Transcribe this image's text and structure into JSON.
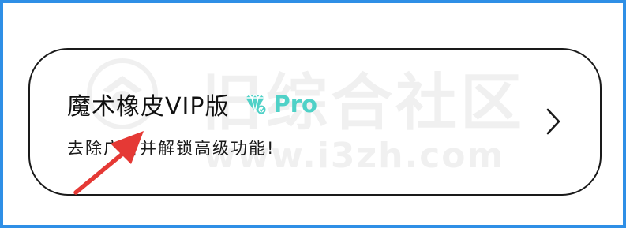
{
  "card": {
    "title": "魔术橡皮VIP版",
    "badge_text": "Pro",
    "subtitle": "去除广告并解锁高级功能!",
    "badge_icon": "diamond-crown-icon",
    "chevron_icon": "chevron-right-icon"
  },
  "watermark": {
    "chinese": "旧综合社区",
    "url": "www.i3zh.com"
  },
  "colors": {
    "frame": "#2f8fe6",
    "badge": "#4fd1c7",
    "arrow": "#e53935",
    "text": "#111111"
  }
}
